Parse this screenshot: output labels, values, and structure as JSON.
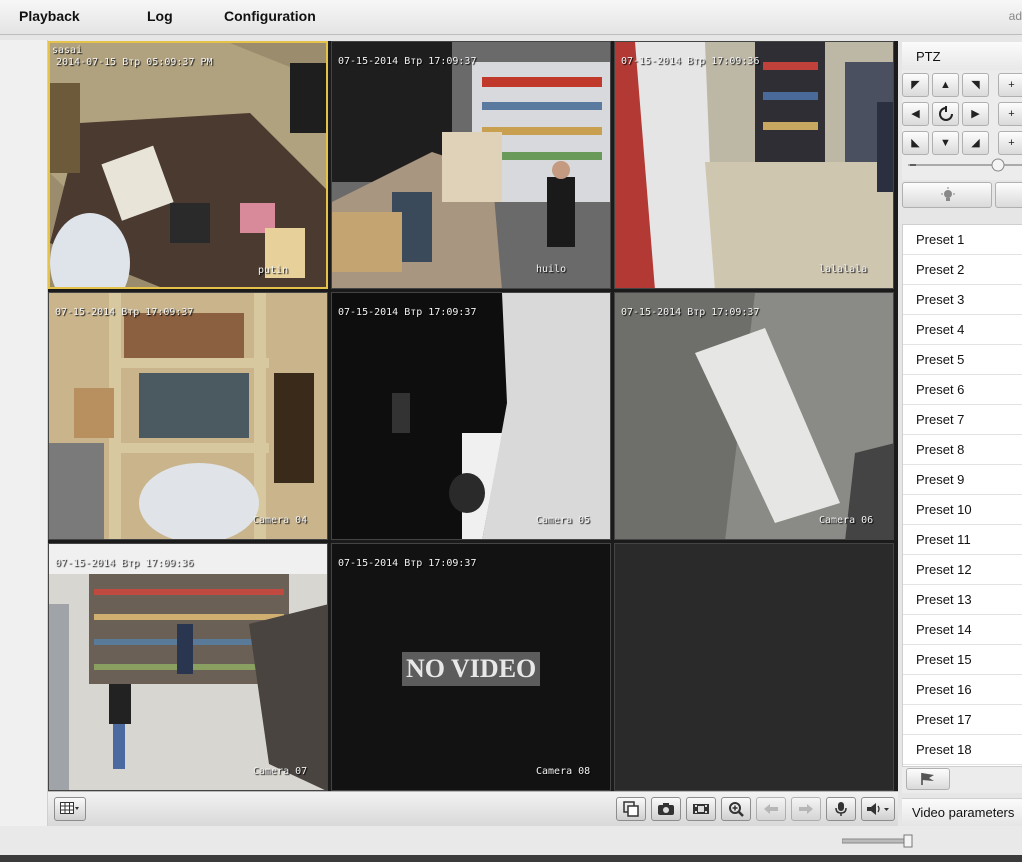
{
  "menu": {
    "playback": "Playback",
    "log": "Log",
    "configuration": "Configuration",
    "user": "ad"
  },
  "cameras": [
    {
      "osd_top": "sasai",
      "timestamp": "2014-07-15 Втр 05:09:37 PM",
      "label": "putin",
      "video": true,
      "selected": true
    },
    {
      "timestamp": "07-15-2014 Втр 17:09:37",
      "label": "huilo",
      "video": true
    },
    {
      "timestamp": "07-15-2014 Втр 17:09:36",
      "label": "lalalala",
      "video": true
    },
    {
      "timestamp": "07-15-2014 Втр 17:09:37",
      "label": "Camera 04",
      "video": true
    },
    {
      "timestamp": "07-15-2014 Втр 17:09:37",
      "label": "Camera 05",
      "video": true
    },
    {
      "timestamp": "07-15-2014 Втр 17:09:37",
      "label": "Camera 06",
      "video": true
    },
    {
      "timestamp": "07-15-2014 Втр 17:09:36",
      "label": "Camera 07",
      "video": true
    },
    {
      "timestamp": "07-15-2014 Втр 17:09:37",
      "label": "Camera 08",
      "video": false,
      "no_video_text": "NO VIDEO"
    },
    {
      "video": false,
      "empty": true
    }
  ],
  "toolbar": {
    "layout_icon": "grid-layout-icon",
    "tools": [
      "window-icon",
      "camera-snapshot-icon",
      "film-record-icon",
      "zoom-in-icon",
      "arrow-left-icon",
      "arrow-right-icon",
      "microphone-icon",
      "speaker-icon"
    ]
  },
  "ptz": {
    "title": "PTZ",
    "center_icon": "auto-rotate-icon"
  },
  "presets": [
    "Preset 1",
    "Preset 2",
    "Preset 3",
    "Preset 4",
    "Preset 5",
    "Preset 6",
    "Preset 7",
    "Preset 8",
    "Preset 9",
    "Preset 10",
    "Preset 11",
    "Preset 12",
    "Preset 13",
    "Preset 14",
    "Preset 15",
    "Preset 16",
    "Preset 17",
    "Preset 18"
  ],
  "video_parameters": "Video parameters",
  "colors": {
    "selected_border": "#e5c24a",
    "grid_background": "#1b1b1b"
  }
}
